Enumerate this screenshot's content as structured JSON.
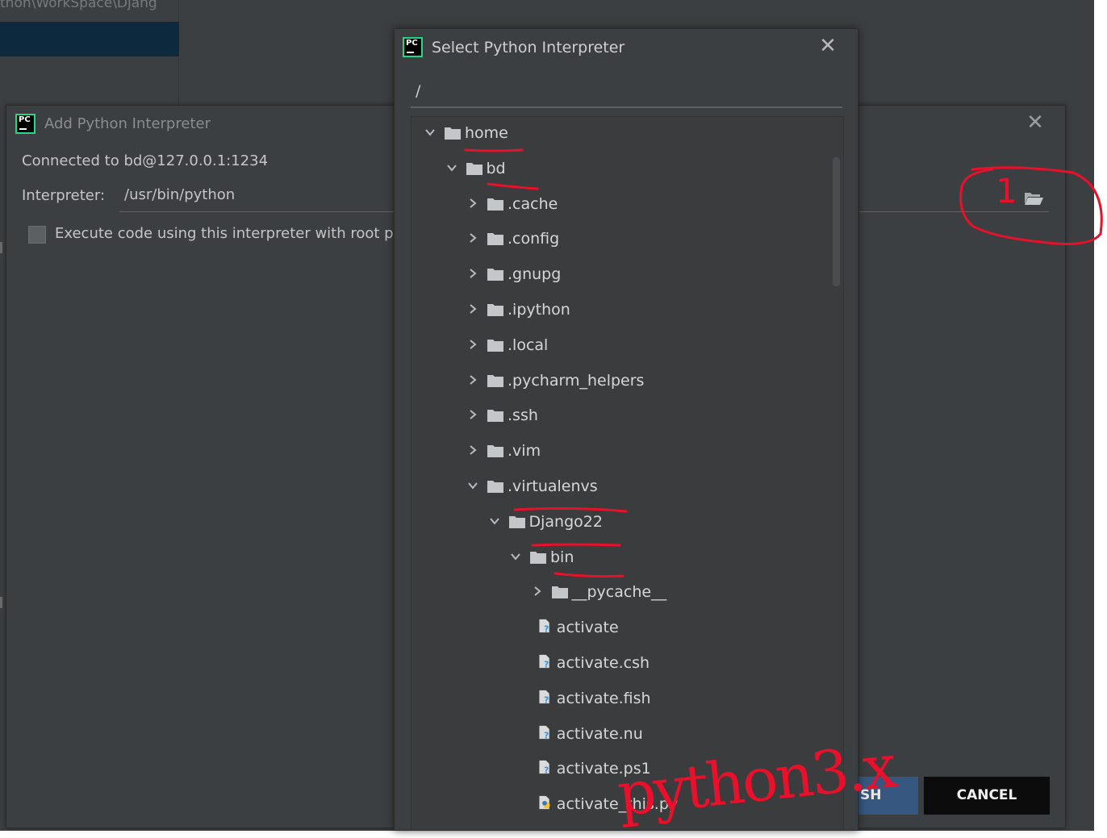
{
  "ide": {
    "path_text": "thon\\WorkSpace\\Djang"
  },
  "add_dialog": {
    "title": "Add Python Interpreter",
    "connected": "Connected to bd@127.0.0.1:1234",
    "interpreter_label": "Interpreter:",
    "interpreter_value": "/usr/bin/python",
    "checkbox_label": "Execute code using this interpreter with root p",
    "finish_label": "SH",
    "cancel_label": "CANCEL"
  },
  "select_dialog": {
    "title": "Select Python Interpreter",
    "path": "/",
    "tree": [
      {
        "label": "home",
        "depth": 0,
        "state": "expanded",
        "kind": "folder"
      },
      {
        "label": "bd",
        "depth": 1,
        "state": "expanded",
        "kind": "folder"
      },
      {
        "label": ".cache",
        "depth": 2,
        "state": "collapsed",
        "kind": "folder"
      },
      {
        "label": ".config",
        "depth": 2,
        "state": "collapsed",
        "kind": "folder"
      },
      {
        "label": ".gnupg",
        "depth": 2,
        "state": "collapsed",
        "kind": "folder"
      },
      {
        "label": ".ipython",
        "depth": 2,
        "state": "collapsed",
        "kind": "folder"
      },
      {
        "label": ".local",
        "depth": 2,
        "state": "collapsed",
        "kind": "folder"
      },
      {
        "label": ".pycharm_helpers",
        "depth": 2,
        "state": "collapsed",
        "kind": "folder"
      },
      {
        "label": ".ssh",
        "depth": 2,
        "state": "collapsed",
        "kind": "folder"
      },
      {
        "label": ".vim",
        "depth": 2,
        "state": "collapsed",
        "kind": "folder"
      },
      {
        "label": ".virtualenvs",
        "depth": 2,
        "state": "expanded",
        "kind": "folder"
      },
      {
        "label": "Django22",
        "depth": 3,
        "state": "expanded",
        "kind": "folder"
      },
      {
        "label": "bin",
        "depth": 4,
        "state": "expanded",
        "kind": "folder"
      },
      {
        "label": "__pycache__",
        "depth": 5,
        "state": "collapsed",
        "kind": "folder"
      },
      {
        "label": "activate",
        "depth": 6,
        "state": "leaf",
        "kind": "unknown-file"
      },
      {
        "label": "activate.csh",
        "depth": 6,
        "state": "leaf",
        "kind": "unknown-file"
      },
      {
        "label": "activate.fish",
        "depth": 6,
        "state": "leaf",
        "kind": "unknown-file"
      },
      {
        "label": "activate.nu",
        "depth": 6,
        "state": "leaf",
        "kind": "unknown-file"
      },
      {
        "label": "activate.ps1",
        "depth": 6,
        "state": "leaf",
        "kind": "unknown-file"
      },
      {
        "label": "activate_this.py",
        "depth": 6,
        "state": "leaf",
        "kind": "python-file"
      }
    ]
  },
  "annotations": {
    "handwritten_text": "python3.x",
    "handwritten_number": "1",
    "color": "#e8102a"
  },
  "colors": {
    "dialog_bg": "#3c3f41",
    "folder_icon": "#c4c7c9",
    "finish_button": "#365880",
    "cancel_button": "#0c0c0c"
  }
}
